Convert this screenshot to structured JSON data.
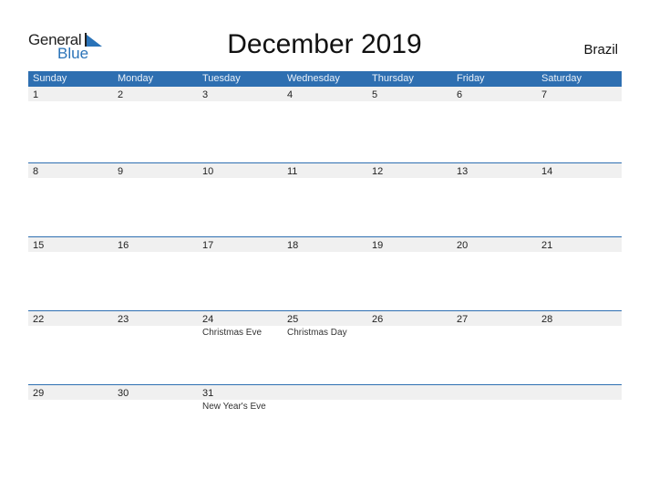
{
  "logo": {
    "line1": "General",
    "line2": "Blue"
  },
  "title": "December 2019",
  "country": "Brazil",
  "colors": {
    "accent": "#2e6fb1",
    "strip": "#f0f0f0"
  },
  "weekdays": [
    "Sunday",
    "Monday",
    "Tuesday",
    "Wednesday",
    "Thursday",
    "Friday",
    "Saturday"
  ],
  "weeks": [
    [
      {
        "day": "1",
        "event": ""
      },
      {
        "day": "2",
        "event": ""
      },
      {
        "day": "3",
        "event": ""
      },
      {
        "day": "4",
        "event": ""
      },
      {
        "day": "5",
        "event": ""
      },
      {
        "day": "6",
        "event": ""
      },
      {
        "day": "7",
        "event": ""
      }
    ],
    [
      {
        "day": "8",
        "event": ""
      },
      {
        "day": "9",
        "event": ""
      },
      {
        "day": "10",
        "event": ""
      },
      {
        "day": "11",
        "event": ""
      },
      {
        "day": "12",
        "event": ""
      },
      {
        "day": "13",
        "event": ""
      },
      {
        "day": "14",
        "event": ""
      }
    ],
    [
      {
        "day": "15",
        "event": ""
      },
      {
        "day": "16",
        "event": ""
      },
      {
        "day": "17",
        "event": ""
      },
      {
        "day": "18",
        "event": ""
      },
      {
        "day": "19",
        "event": ""
      },
      {
        "day": "20",
        "event": ""
      },
      {
        "day": "21",
        "event": ""
      }
    ],
    [
      {
        "day": "22",
        "event": ""
      },
      {
        "day": "23",
        "event": ""
      },
      {
        "day": "24",
        "event": "Christmas Eve"
      },
      {
        "day": "25",
        "event": "Christmas Day"
      },
      {
        "day": "26",
        "event": ""
      },
      {
        "day": "27",
        "event": ""
      },
      {
        "day": "28",
        "event": ""
      }
    ],
    [
      {
        "day": "29",
        "event": ""
      },
      {
        "day": "30",
        "event": ""
      },
      {
        "day": "31",
        "event": "New Year's Eve"
      },
      {
        "day": "",
        "event": ""
      },
      {
        "day": "",
        "event": ""
      },
      {
        "day": "",
        "event": ""
      },
      {
        "day": "",
        "event": ""
      }
    ]
  ]
}
